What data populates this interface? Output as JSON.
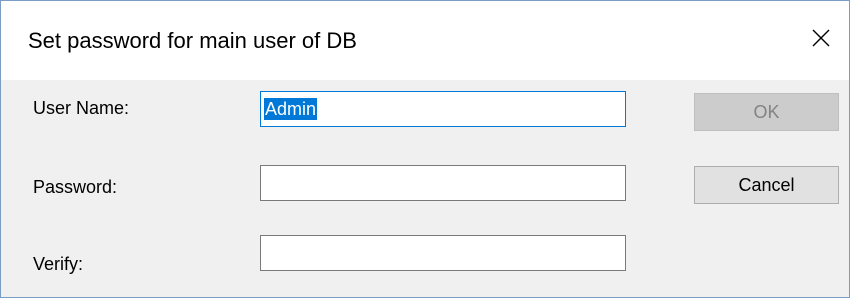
{
  "dialog": {
    "title": "Set password for main user of DB",
    "close_icon": "close-icon"
  },
  "form": {
    "username_label": "User Name:",
    "username_value": "Admin",
    "password_label": "Password:",
    "password_value": "",
    "verify_label": "Verify:",
    "verify_value": ""
  },
  "buttons": {
    "ok_label": "OK",
    "ok_enabled": false,
    "cancel_label": "Cancel"
  },
  "colors": {
    "accent": "#0078d7",
    "dialog_background": "#f0f0f0",
    "titlebar_background": "#ffffff"
  }
}
